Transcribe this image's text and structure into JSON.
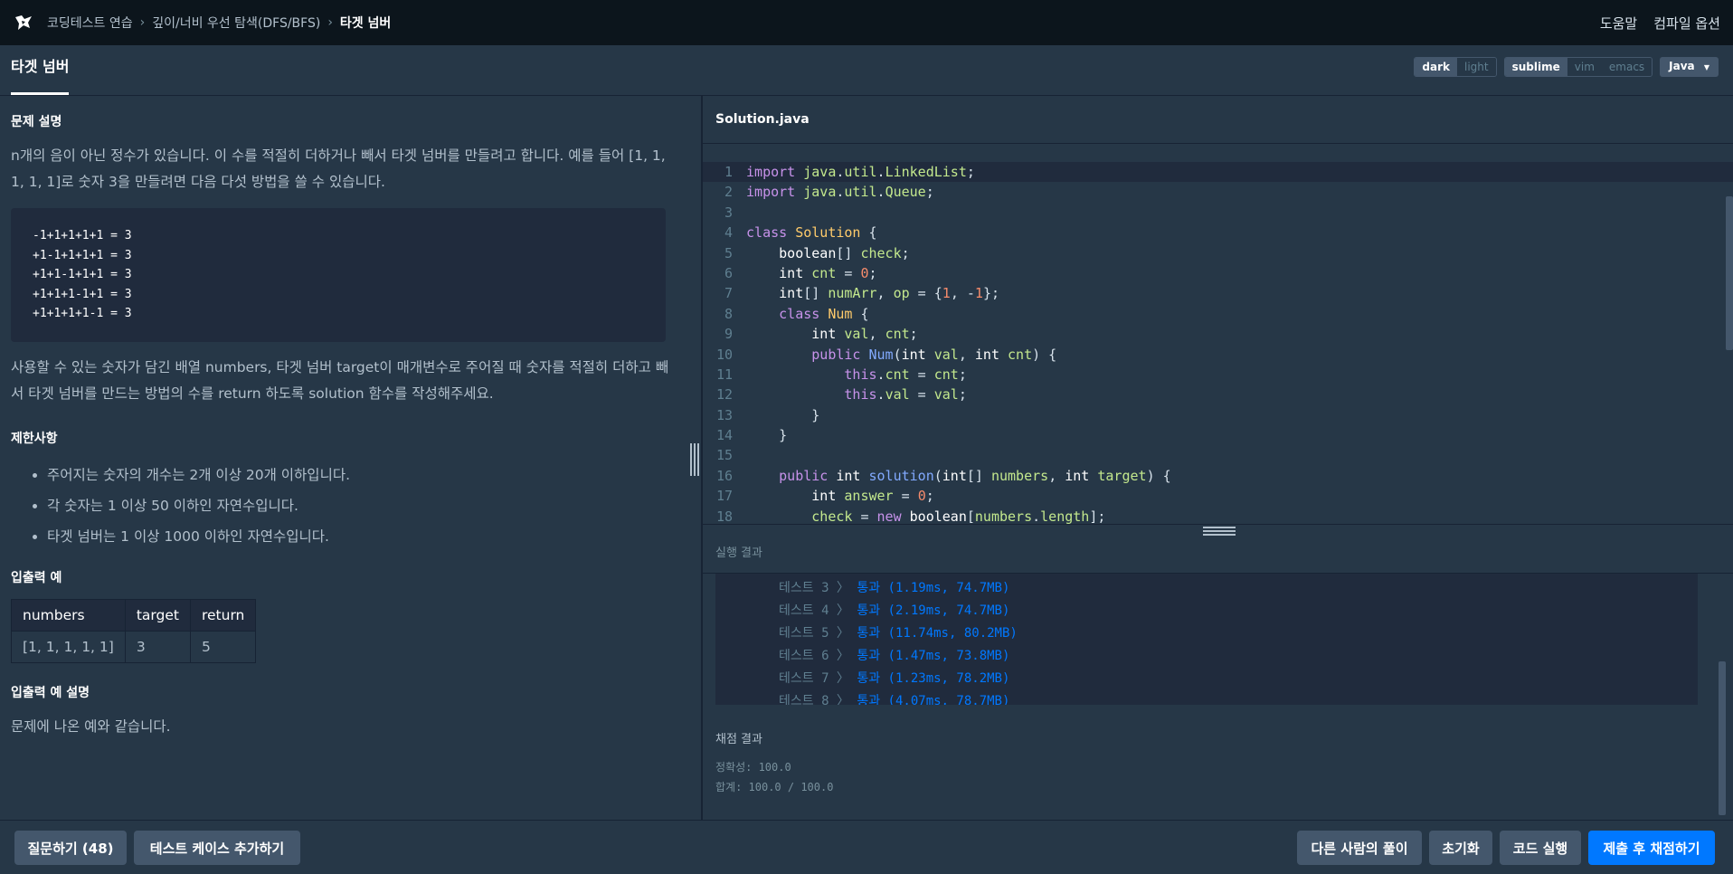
{
  "breadcrumb": {
    "items": [
      "코딩테스트 연습",
      "깊이/너비 우선 탐색(DFS/BFS)"
    ],
    "current": "타겟 넘버"
  },
  "header": {
    "help": "도움말",
    "compile_options": "컴파일 옵션"
  },
  "tab": {
    "title": "타겟 넘버"
  },
  "theme": {
    "dark": "dark",
    "light": "light"
  },
  "keymap": {
    "sublime": "sublime",
    "vim": "vim",
    "emacs": "emacs"
  },
  "language": {
    "selected": "Java"
  },
  "problem": {
    "section1": "문제 설명",
    "p1": "n개의 음이 아닌 정수가 있습니다. 이 수를 적절히 더하거나 빼서 타겟 넘버를 만들려고 합니다. 예를 들어 [1, 1, 1, 1, 1]로 숫자 3을 만들려면 다음 다섯 방법을 쓸 수 있습니다.",
    "examples": [
      "-1+1+1+1+1 = 3",
      "+1-1+1+1+1 = 3",
      "+1+1-1+1+1 = 3",
      "+1+1+1-1+1 = 3",
      "+1+1+1+1-1 = 3"
    ],
    "p2": "사용할 수 있는 숫자가 담긴 배열 numbers, 타겟 넘버 target이 매개변수로 주어질 때 숫자를 적절히 더하고 빼서 타겟 넘버를 만드는 방법의 수를 return 하도록 solution 함수를 작성해주세요.",
    "section2": "제한사항",
    "constraints": [
      "주어지는 숫자의 개수는 2개 이상 20개 이하입니다.",
      "각 숫자는 1 이상 50 이하인 자연수입니다.",
      "타겟 넘버는 1 이상 1000 이하인 자연수입니다."
    ],
    "section3": "입출력 예",
    "io_headers": [
      "numbers",
      "target",
      "return"
    ],
    "io_row": [
      "[1, 1, 1, 1, 1]",
      "3",
      "5"
    ],
    "section4": "입출력 예 설명",
    "p3": "문제에 나온 예와 같습니다."
  },
  "editor": {
    "filename": "Solution.java",
    "line_numbers": [
      "1",
      "2",
      "3",
      "4",
      "5",
      "6",
      "7",
      "8",
      "9",
      "10",
      "11",
      "12",
      "13",
      "14",
      "15",
      "16",
      "17",
      "18"
    ]
  },
  "results": {
    "label": "실행 결과",
    "tests": [
      {
        "name": "테스트 3",
        "result": "통과 (1.19ms, 74.7MB)"
      },
      {
        "name": "테스트 4",
        "result": "통과 (2.19ms, 74.7MB)"
      },
      {
        "name": "테스트 5",
        "result": "통과 (11.74ms, 80.2MB)"
      },
      {
        "name": "테스트 6",
        "result": "통과 (1.47ms, 73.8MB)"
      },
      {
        "name": "테스트 7",
        "result": "통과 (1.23ms, 78.2MB)"
      },
      {
        "name": "테스트 8",
        "result": "통과 (4.07ms, 78.7MB)"
      }
    ],
    "score_title": "채점 결과",
    "accuracy": "정확성: 100.0",
    "total": "합계: 100.0 / 100.0"
  },
  "footer": {
    "question": "질문하기 (48)",
    "add_test": "테스트 케이스 추가하기",
    "others": "다른 사람의 풀이",
    "reset": "초기화",
    "run": "코드 실행",
    "submit": "제출 후 채점하기"
  }
}
